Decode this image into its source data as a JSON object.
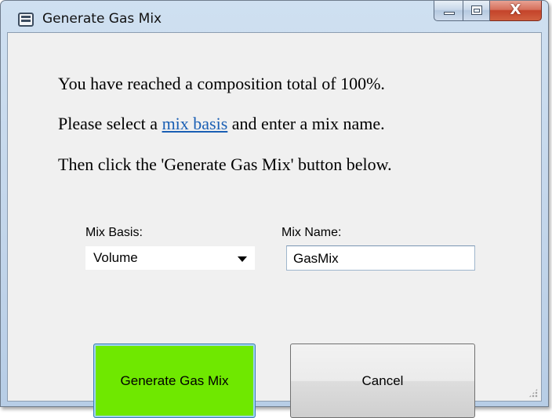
{
  "window": {
    "title": "Generate Gas Mix",
    "icon": "app-window-icon",
    "caption_buttons": {
      "minimize_icon": "minimize-icon",
      "maximize_icon": "maximize-icon",
      "close_glyph": "X"
    }
  },
  "message": {
    "line1": "You have reached a composition total of 100%.",
    "line2_before": "Please select a ",
    "line2_link": "mix basis",
    "line2_after": " and enter a mix name.",
    "line3": "Then click the 'Generate Gas Mix' button below."
  },
  "form": {
    "mix_basis_label": "Mix Basis:",
    "mix_basis_value": "Volume",
    "mix_name_label": "Mix Name:",
    "mix_name_value": "GasMix"
  },
  "buttons": {
    "generate_label": "Generate Gas Mix",
    "cancel_label": "Cancel"
  },
  "colors": {
    "generate_button": "#6fe800",
    "link": "#1a5fb4",
    "close_button": "#c4432a"
  }
}
